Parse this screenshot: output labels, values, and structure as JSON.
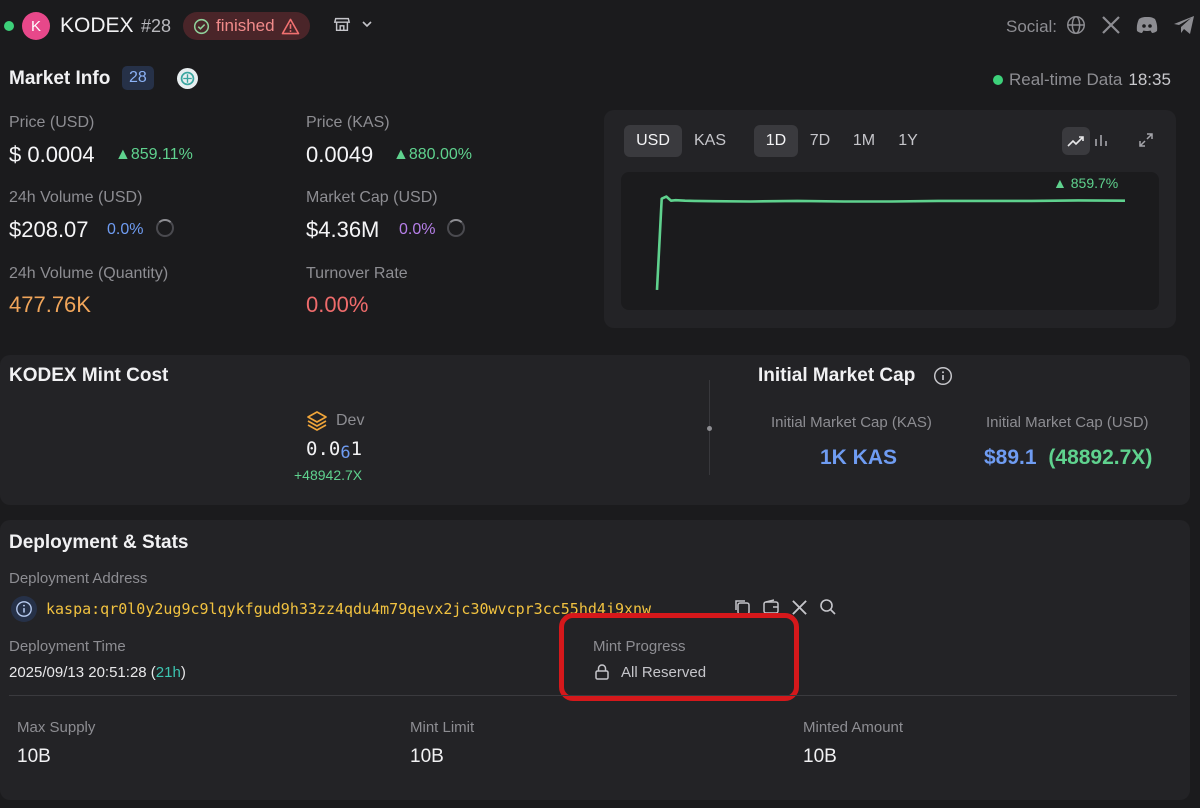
{
  "header": {
    "logo_letter": "K",
    "token_name": "KODEX",
    "rank": "#28",
    "status_badge": "finished",
    "social_label": "Social:"
  },
  "market_info": {
    "title": "Market Info",
    "count": "28",
    "realtime_label": "Real-time Data",
    "time": "18:35",
    "price_usd_label": "Price (USD)",
    "price_usd": "$ 0.0004",
    "price_usd_change": "▲859.11%",
    "price_kas_label": "Price (KAS)",
    "price_kas": "0.0049",
    "price_kas_change": "▲880.00%",
    "vol_usd_label": "24h Volume (USD)",
    "vol_usd": "$208.07",
    "vol_usd_change": "0.0%",
    "mcap_label": "Market Cap (USD)",
    "mcap": "$4.36M",
    "mcap_change": "0.0%",
    "vol_qty_label": "24h Volume (Quantity)",
    "vol_qty": "477.76K",
    "turnover_label": "Turnover Rate",
    "turnover": "0.00%"
  },
  "chart_panel": {
    "currency_tabs": [
      "USD",
      "KAS"
    ],
    "active_currency": "USD",
    "range_tabs": [
      "1D",
      "7D",
      "1M",
      "1Y"
    ],
    "active_range": "1D",
    "change_label": "▲ 859.7%",
    "line_color": "#5fd28e"
  },
  "chart_data": {
    "type": "line",
    "title": "",
    "x": [
      0,
      1,
      2,
      3,
      4,
      5,
      6,
      8,
      12,
      20,
      30,
      40,
      50,
      60,
      70,
      80,
      90,
      100
    ],
    "y": [
      4e-05,
      0.0004,
      0.000408,
      0.000392,
      0.000394,
      0.000393,
      0.000392,
      0.000391,
      0.00039,
      0.000389,
      0.000391,
      0.000389,
      0.000389,
      0.000391,
      0.000391,
      0.000391,
      0.000393,
      0.000392
    ],
    "ylim": [
      0,
      0.00045
    ],
    "grid": false
  },
  "mint_cost": {
    "title": "KODEX Mint Cost",
    "dev_label": "Dev",
    "value_prefix": "0.0",
    "value_sub": "6",
    "value_suffix": "1",
    "multiplier": "+48942.7X"
  },
  "initial_mcap": {
    "title": "Initial Market Cap",
    "kas_label": "Initial Market Cap (KAS)",
    "kas_value": "1K KAS",
    "usd_label": "Initial Market Cap (USD)",
    "usd_value": "$89.1",
    "usd_multiplier": "(48892.7X)"
  },
  "deployment": {
    "title": "Deployment & Stats",
    "address_label": "Deployment Address",
    "address": "kaspa:qr0l0y2ug9c9lqykfgud9h33zz4qdu4m79qevx2jc30wvcpr3cc55hd4j9xnw",
    "time_label": "Deployment Time",
    "time_value": "2025/09/13 20:51:28 (",
    "time_ago": "21h",
    "time_close": ")",
    "mint_progress_label": "Mint Progress",
    "mint_progress_value": "All Reserved",
    "max_supply_label": "Max Supply",
    "max_supply": "10B",
    "mint_limit_label": "Mint Limit",
    "mint_limit": "10B",
    "minted_label": "Minted Amount",
    "minted": "10B"
  }
}
